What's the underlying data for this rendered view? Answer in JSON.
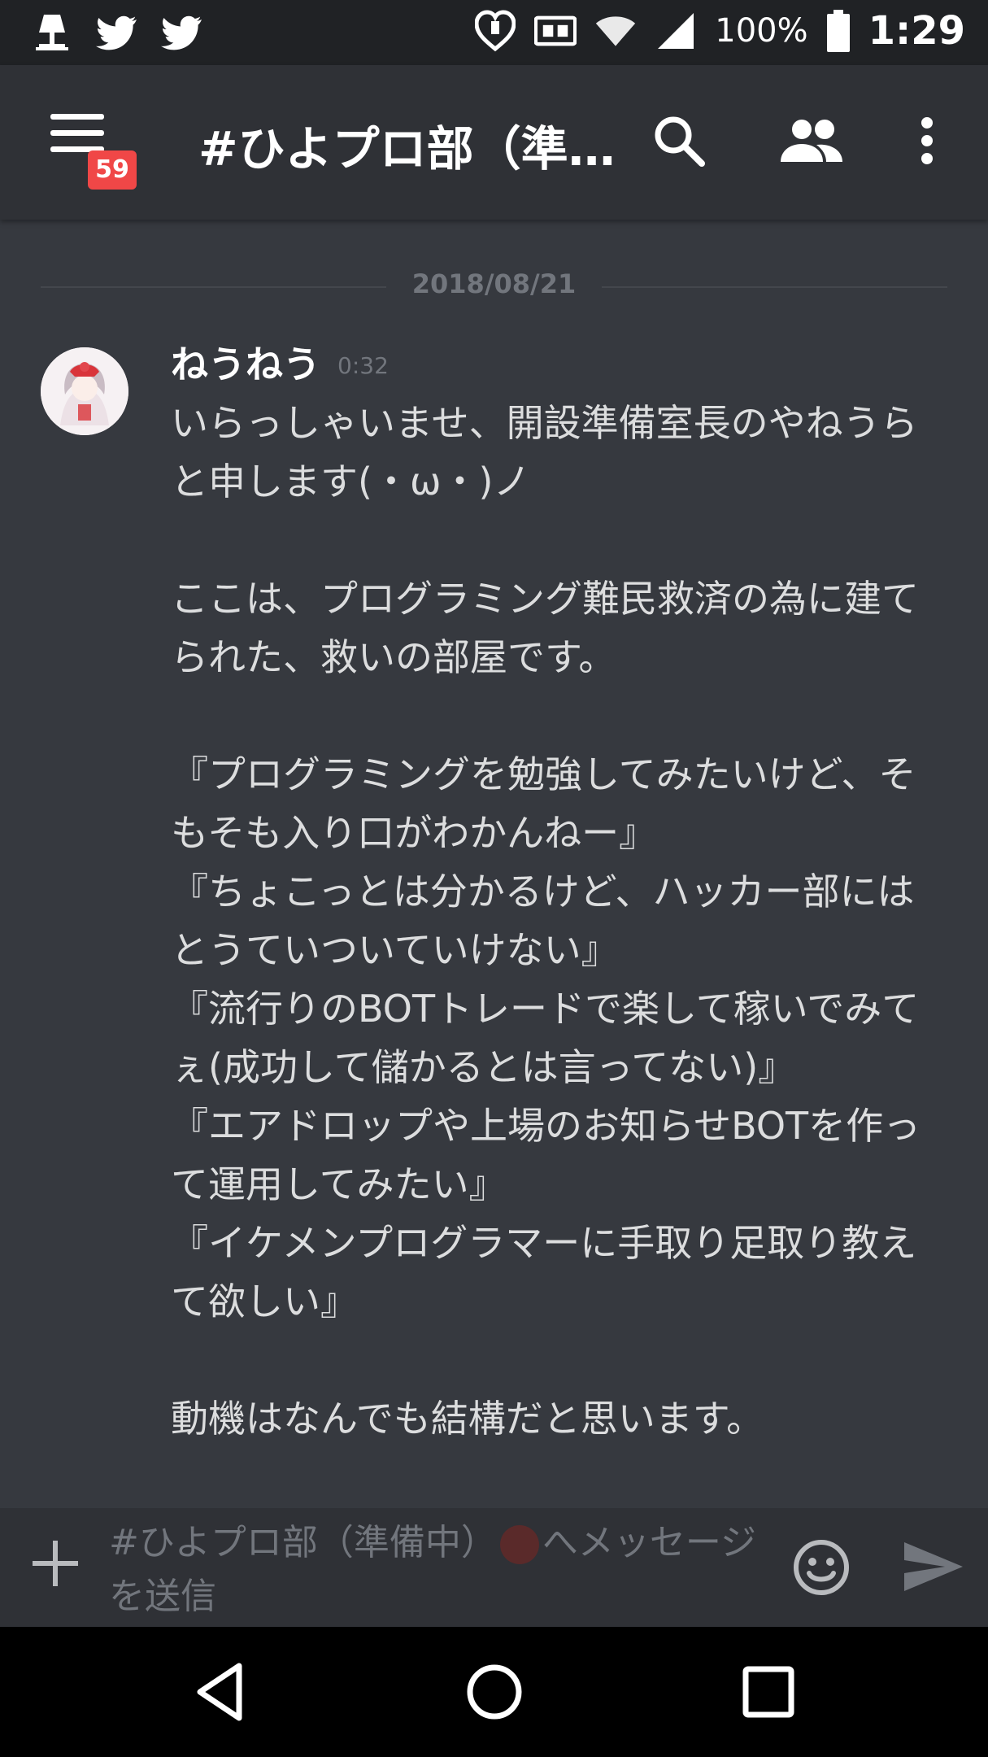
{
  "status_bar": {
    "battery": "100%",
    "time": "1:29"
  },
  "app_bar": {
    "channel_title": "#ひよプロ部（準…",
    "unread_badge": "59"
  },
  "messages": {
    "date_divider": "2018/08/21",
    "items": [
      {
        "author": "ねうねう",
        "time": "0:32",
        "text": "いらっしゃいませ、開設準備室長のやねうらと申します(・ω・)ノ\n\nここは、プログラミング難民救済の為に建てられた、救いの部屋です。\n\n『プログラミングを勉強してみたいけど、そもそも入り口がわかんねー』\n『ちょこっとは分かるけど、ハッカー部にはとうていついていけない』\n『流行りのBOTトレードで楽して稼いでみてぇ(成功して儲かるとは言ってない)』\n『エアドロップや上場のお知らせBOTを作って運用してみたい』\n『イケメンプログラマーに手取り足取り教えて欲しい』\n\n動機はなんでも結構だと思います。"
      }
    ]
  },
  "composer": {
    "placeholder_before": "#ひよプロ部（準備中）",
    "placeholder_after": "へメッセージを送信"
  },
  "colors": {
    "background": "#36393f",
    "app_bar": "#2f3136",
    "status_bar": "#202225",
    "badge": "#f04747"
  }
}
